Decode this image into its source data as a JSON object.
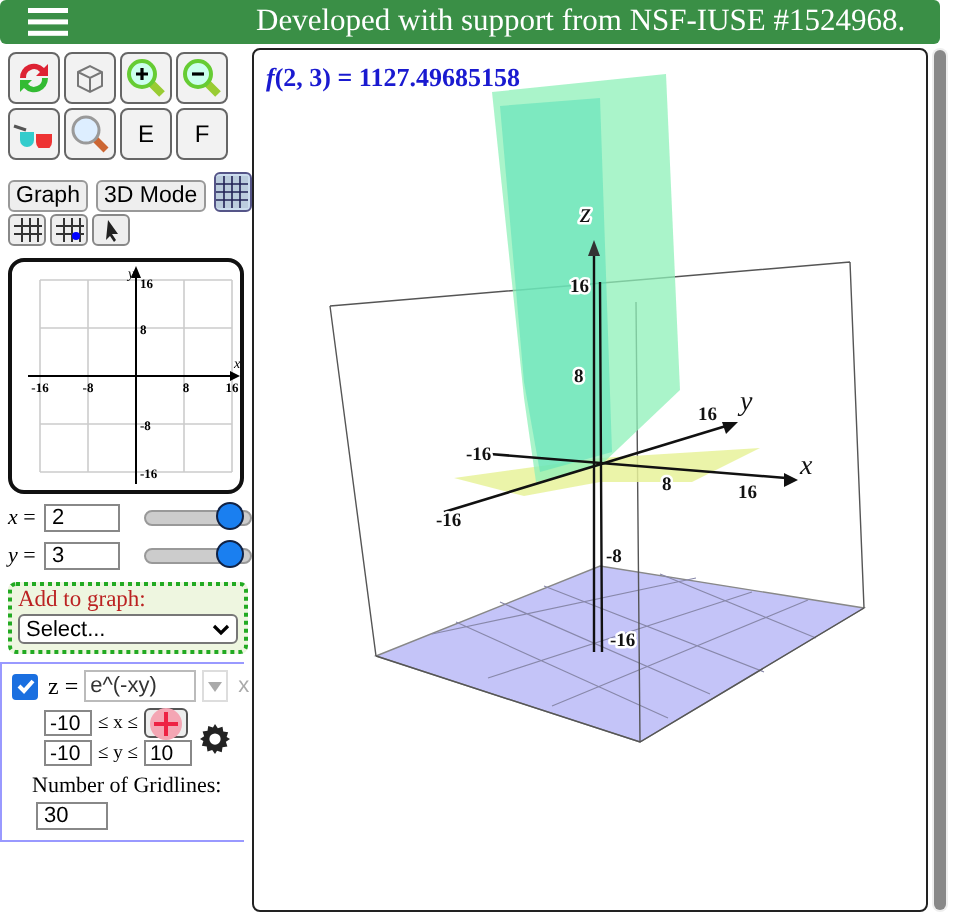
{
  "header": {
    "title": "Developed with support from NSF-IUSE #1524968."
  },
  "letter_buttons": [
    "E",
    "F"
  ],
  "mode_buttons": [
    "Graph",
    "3D Mode"
  ],
  "graph2d": {
    "x_label": "x",
    "y_label": "y",
    "x_ticks": [
      "-16",
      "-8",
      "8",
      "16"
    ],
    "y_ticks": [
      "16",
      "8",
      "-8",
      "-16"
    ]
  },
  "variables": [
    {
      "label": "*x* =",
      "value": "2",
      "level": 0.8
    },
    {
      "label": "*y* =",
      "value": "3",
      "level": 0.8
    }
  ],
  "add_to_graph": {
    "label": "Add to graph:",
    "select": "Select..."
  },
  "function": {
    "checked": true,
    "lhs": "z =",
    "expr": "e^(-xy)",
    "remove": "x",
    "x_min": "-10",
    "x_var": "≤ x ≤",
    "y_min": "-10",
    "y_var": "≤ y ≤",
    "y_max": "10",
    "gridlines_label": "Number of Gridlines:",
    "gridlines": "30"
  },
  "plot": {
    "readout": "*f*(2, 3) = 1127.49685158",
    "labels": [
      "z",
      "16",
      "8",
      "-16",
      "-16",
      "y",
      "16",
      "8",
      "16",
      "x",
      "-8",
      "-16"
    ]
  }
}
